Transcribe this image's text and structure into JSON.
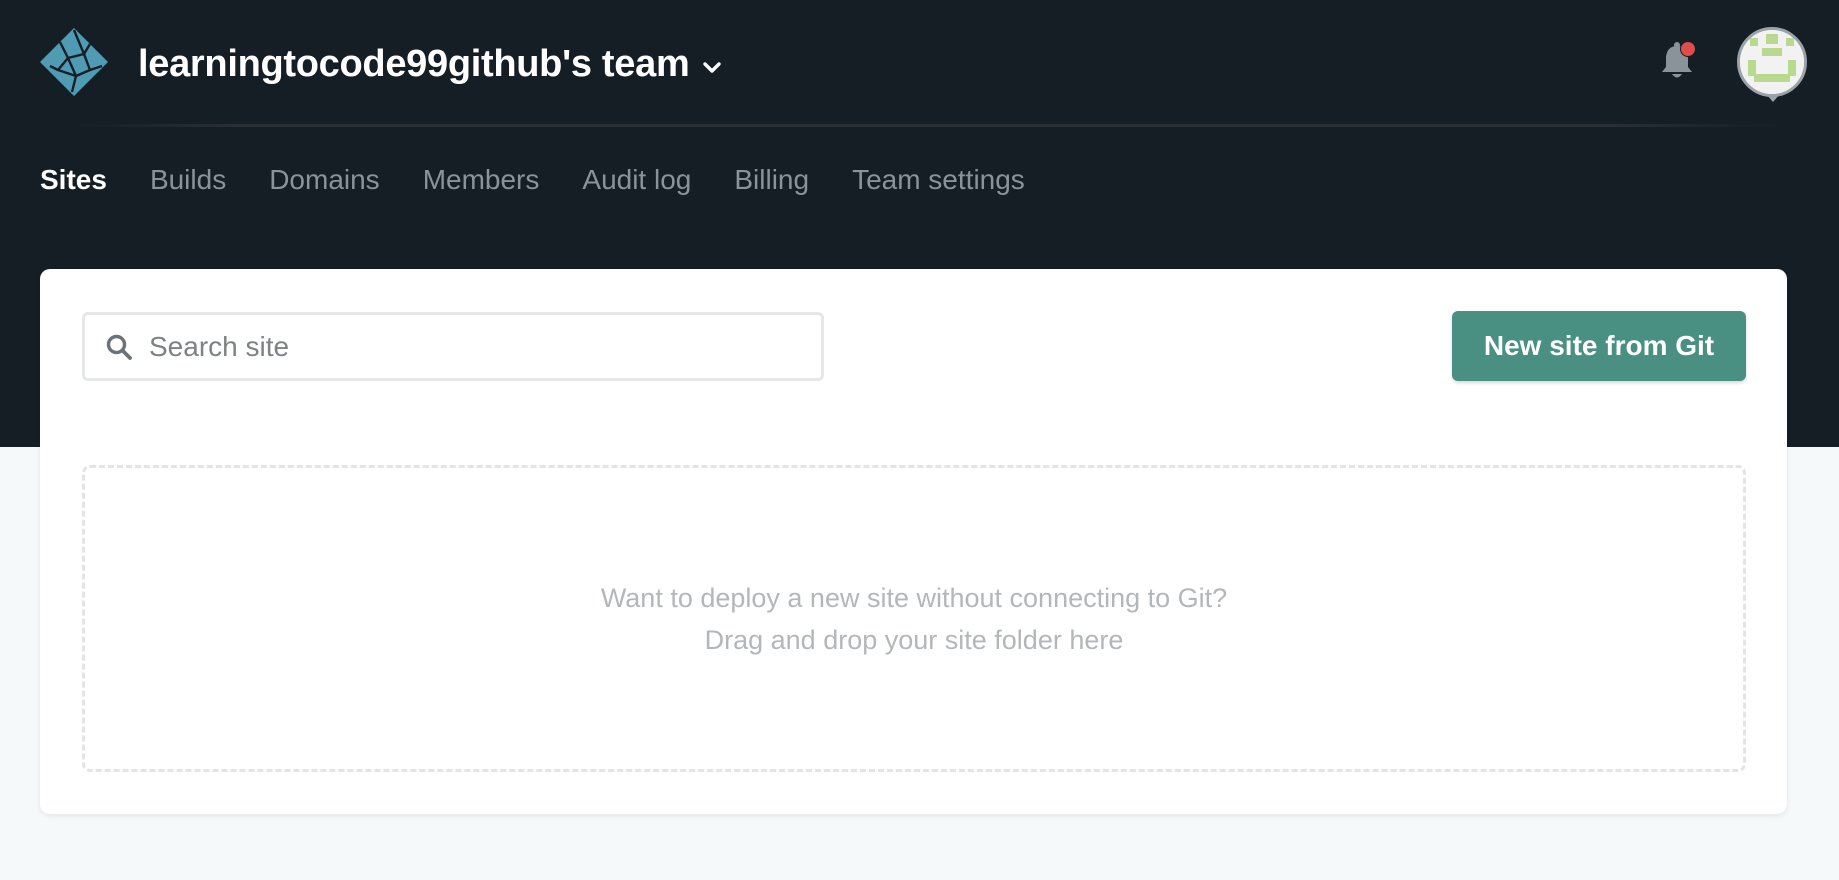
{
  "header": {
    "team_name": "learningtocode99github's team",
    "logo_icon": "netlify-logo-icon",
    "notifications_icon": "bell-icon",
    "has_unread_notifications": true,
    "avatar_icon": "user-avatar-icon"
  },
  "nav": {
    "tabs": [
      {
        "label": "Sites",
        "active": true
      },
      {
        "label": "Builds",
        "active": false
      },
      {
        "label": "Domains",
        "active": false
      },
      {
        "label": "Members",
        "active": false
      },
      {
        "label": "Audit log",
        "active": false
      },
      {
        "label": "Billing",
        "active": false
      },
      {
        "label": "Team settings",
        "active": false
      }
    ]
  },
  "sites": {
    "search": {
      "placeholder": "Search site",
      "value": ""
    },
    "new_site_button": "New site from Git",
    "dropzone": {
      "line1": "Want to deploy a new site without connecting to Git?",
      "line2": "Drag and drop your site folder here"
    }
  },
  "colors": {
    "header_bg": "#161e25",
    "page_bg": "#f6f9f9",
    "primary_button": "#4a9082",
    "notification_dot": "#e04b4b",
    "logo_teal": "#4f9bb3"
  }
}
